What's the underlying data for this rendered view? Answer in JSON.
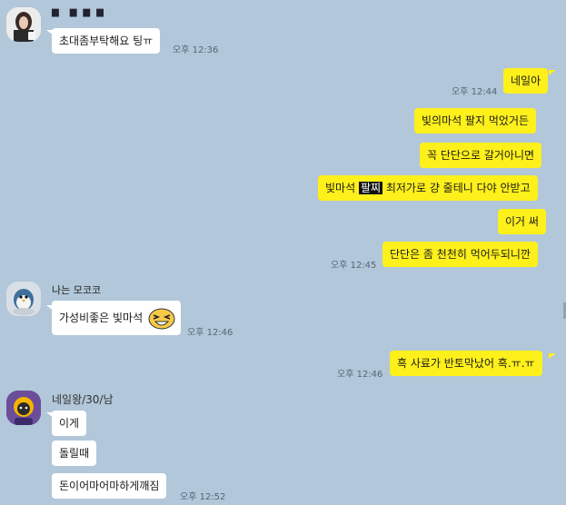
{
  "chat": {
    "messages": {
      "m1": {
        "sender": "▆ ▆ ▆ ▆",
        "text": "초대좀부탁해요 팅ㅠ",
        "time": "오후 12:36"
      },
      "m2": {
        "text": "네일아",
        "time": "오후 12:44"
      },
      "m3": {
        "text": "빛의마석 팔지 먹었거든"
      },
      "m4": {
        "text": "꼭 단단으로 갈거아니면"
      },
      "m5": {
        "pre": "빛마석 ",
        "highlight": "팔찌",
        "post": " 최저가로 걍 줄테니 다야 안받고"
      },
      "m6": {
        "text": "이거 써"
      },
      "m7": {
        "text": "단단은 좀 천천히 먹어두되니깐",
        "time": "오후 12:45"
      },
      "m8": {
        "sender": "나는 모코코",
        "text": "가성비좋은 빛마석",
        "time": "오후 12:46"
      },
      "m9": {
        "text": "흑 사료가 반토막났어 흑.ㅠ.ㅠ",
        "time": "오후 12:46"
      },
      "m10": {
        "sender": "네일왕/30/남",
        "text": "이게"
      },
      "m11": {
        "text": "돌릴때"
      },
      "m12": {
        "text": "돈이어마어마하게깨짐",
        "time": "오후 12:52"
      }
    }
  },
  "colors": {
    "background": "#b2c7d9",
    "mine": "#fef01b",
    "theirs": "#ffffff"
  },
  "icons": [
    "avatar-girl",
    "avatar-penguin",
    "avatar-kakao-friend",
    "emoticon-laughing"
  ]
}
